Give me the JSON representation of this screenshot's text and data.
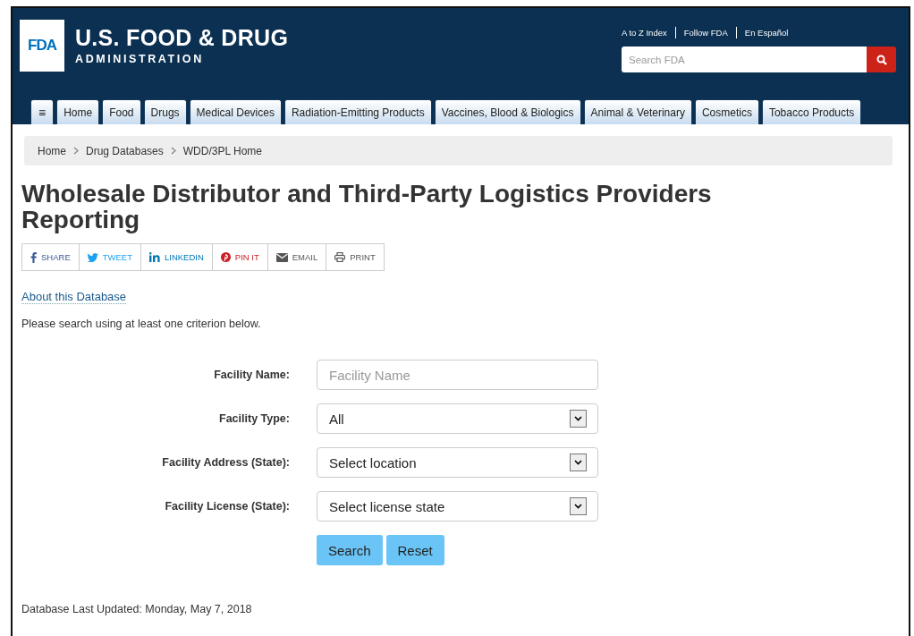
{
  "header": {
    "logo": "FDA",
    "title": "U.S. FOOD & DRUG",
    "subtitle": "ADMINISTRATION",
    "utility_links": [
      "A to Z Index",
      "Follow FDA",
      "En Español"
    ],
    "search": {
      "placeholder": "Search FDA"
    }
  },
  "nav": {
    "menu_icon": "≡",
    "tabs": [
      {
        "label": "Home",
        "selected": false
      },
      {
        "label": "Food",
        "selected": false
      },
      {
        "label": "Drugs",
        "selected": false
      },
      {
        "label": "Medical Devices",
        "selected": false
      },
      {
        "label": "Radiation-Emitting Products",
        "selected": false
      },
      {
        "label": "Vaccines, Blood & Biologics",
        "selected": false
      },
      {
        "label": "Animal & Veterinary",
        "selected": false
      },
      {
        "label": "Cosmetics",
        "selected": false
      },
      {
        "label": "Tobacco Products",
        "selected": false
      }
    ]
  },
  "breadcrumb": [
    "Home",
    "Drug Databases",
    "WDD/3PL Home"
  ],
  "page_title": "Wholesale Distributor and Third-Party Logistics Providers Reporting",
  "share_buttons": [
    {
      "kind": "facebook",
      "label": "SHARE",
      "color": "#3b5998"
    },
    {
      "kind": "twitter",
      "label": "TWEET",
      "color": "#1da1f2"
    },
    {
      "kind": "linkedin",
      "label": "LINKEDIN",
      "color": "#0077b5"
    },
    {
      "kind": "pinterest",
      "label": "PIN IT",
      "color": "#cb2027"
    },
    {
      "kind": "email",
      "label": "EMAIL",
      "color": "#555555"
    },
    {
      "kind": "print",
      "label": "PRINT",
      "color": "#555555"
    }
  ],
  "about_link": "About this Database",
  "instructions": "Please search using at least one criterion below.",
  "form": {
    "fields": [
      {
        "kind": "text",
        "label": "Facility Name:",
        "placeholder": "Facility Name"
      },
      {
        "kind": "select",
        "label": "Facility Type:",
        "value": "All"
      },
      {
        "kind": "select",
        "label": "Facility Address (State):",
        "value": "Select location"
      },
      {
        "kind": "select",
        "label": "Facility License (State):",
        "value": "Select license state"
      }
    ],
    "buttons": [
      "Search",
      "Reset"
    ]
  },
  "last_updated": "Database Last Updated: Monday, May 7, 2018"
}
